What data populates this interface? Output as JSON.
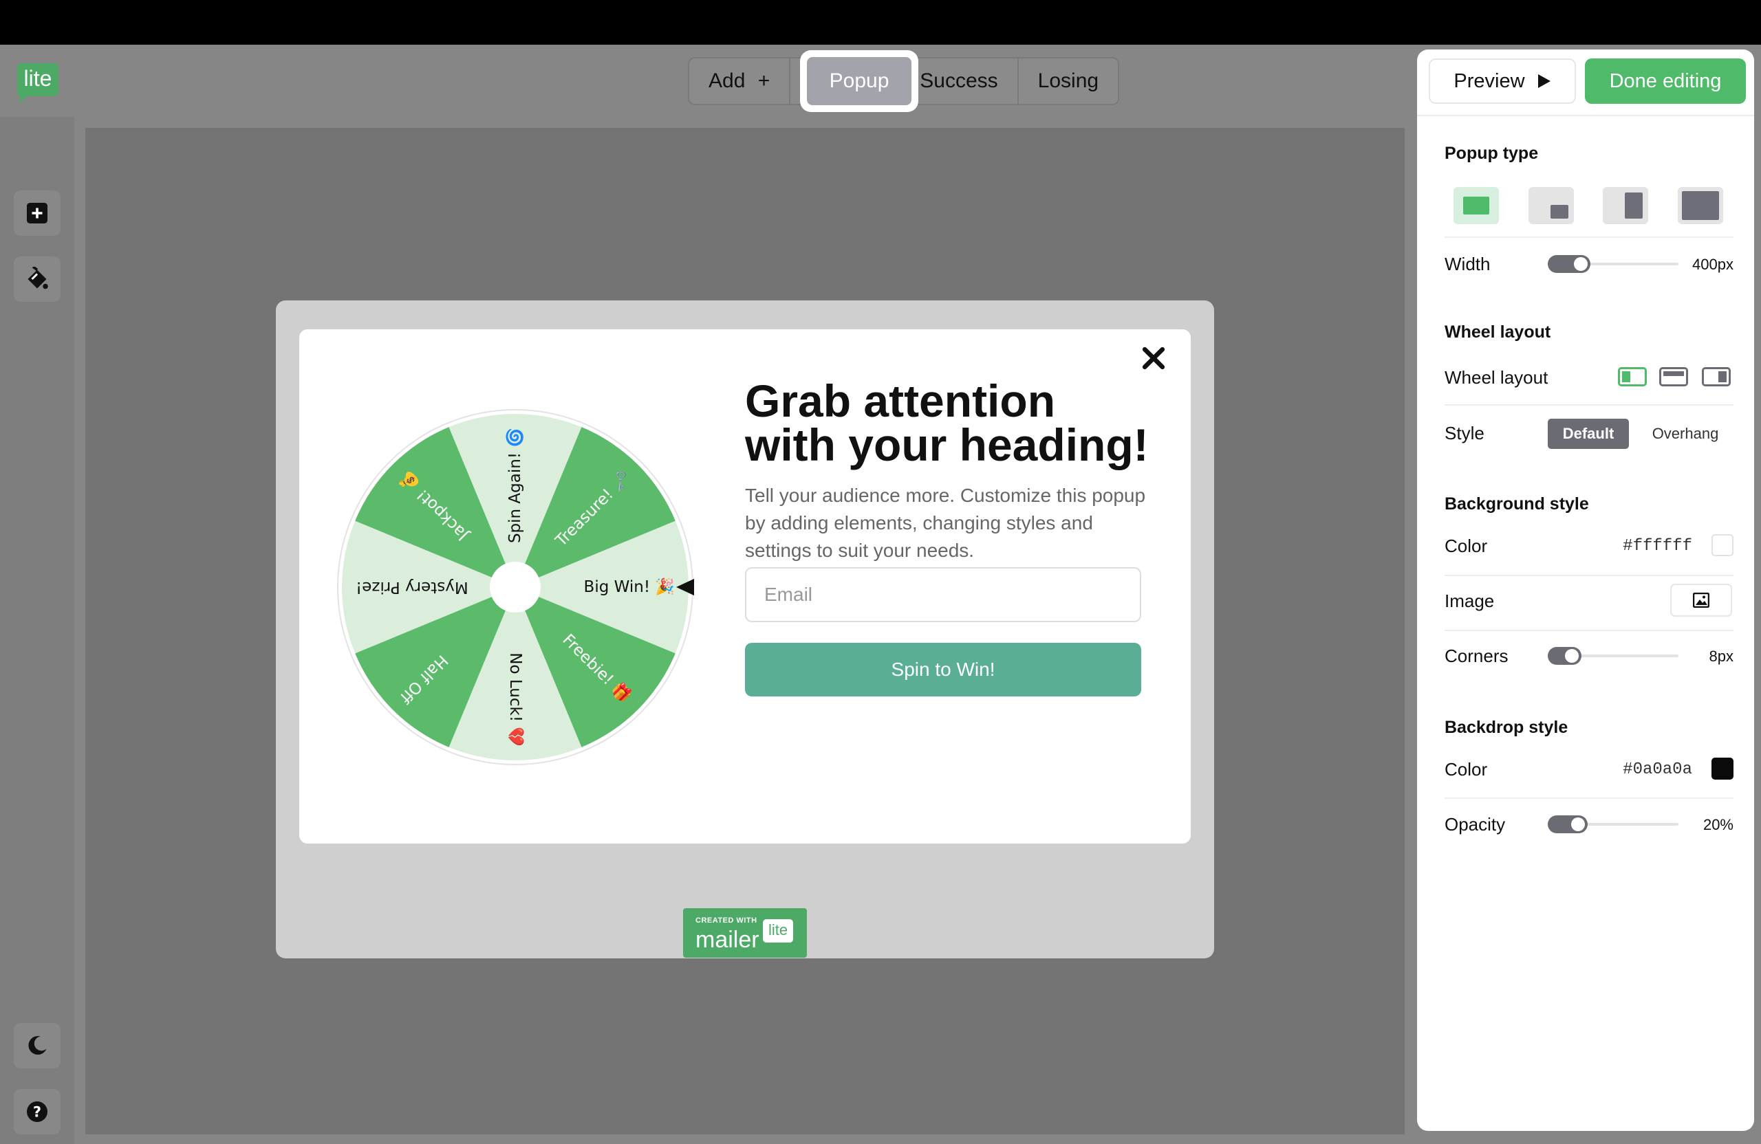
{
  "app": {
    "logo_text": "lite",
    "icons": {
      "add": "add-square-icon",
      "style": "paint-bucket-icon",
      "theme": "moon-icon",
      "help": "help-circle-icon"
    }
  },
  "tabs": {
    "add_label": "Add",
    "popup_label": "Popup",
    "success_label": "Success",
    "losing_label": "Losing"
  },
  "popup": {
    "heading_line1": "Grab attention",
    "heading_line2": "with your heading!",
    "subtext": "Tell your audience more. Customize this popup by adding elements, changing styles and settings to suit your needs.",
    "email_placeholder": "Email",
    "button_label": "Spin to Win!",
    "wheel_segments": [
      "Big Win! 🎉",
      "Freebie! 🎁",
      "No Luck! 💔",
      "Half Off",
      "Mystery Prize!",
      "Jackpot! 💰",
      "Spin Again! 🌀",
      "Treasure! 🗝️"
    ],
    "colors": {
      "segment_dark": "#5cba6b",
      "segment_light": "#dbeedc",
      "button": "#5aae96"
    }
  },
  "badge": {
    "small_text": "CREATED WITH",
    "brand": "mailer",
    "lite": "lite"
  },
  "panel": {
    "preview_label": "Preview",
    "done_label": "Done editing",
    "popup_type_title": "Popup type",
    "width_label": "Width",
    "width_value": "400px",
    "width_fraction": 0.22,
    "wheel_layout_title": "Wheel layout",
    "wheel_layout_label": "Wheel layout",
    "style_label": "Style",
    "style_default": "Default",
    "style_overhang": "Overhang",
    "background_title": "Background style",
    "bg_color_label": "Color",
    "bg_color_value": "#ffffff",
    "image_label": "Image",
    "corners_label": "Corners",
    "corners_value": "8px",
    "corners_fraction": 0.15,
    "backdrop_title": "Backdrop style",
    "backdrop_color_label": "Color",
    "backdrop_color_value": "#0a0a0a",
    "opacity_label": "Opacity",
    "opacity_value": "20%",
    "opacity_fraction": 0.2,
    "accent": "#4fba6a"
  }
}
